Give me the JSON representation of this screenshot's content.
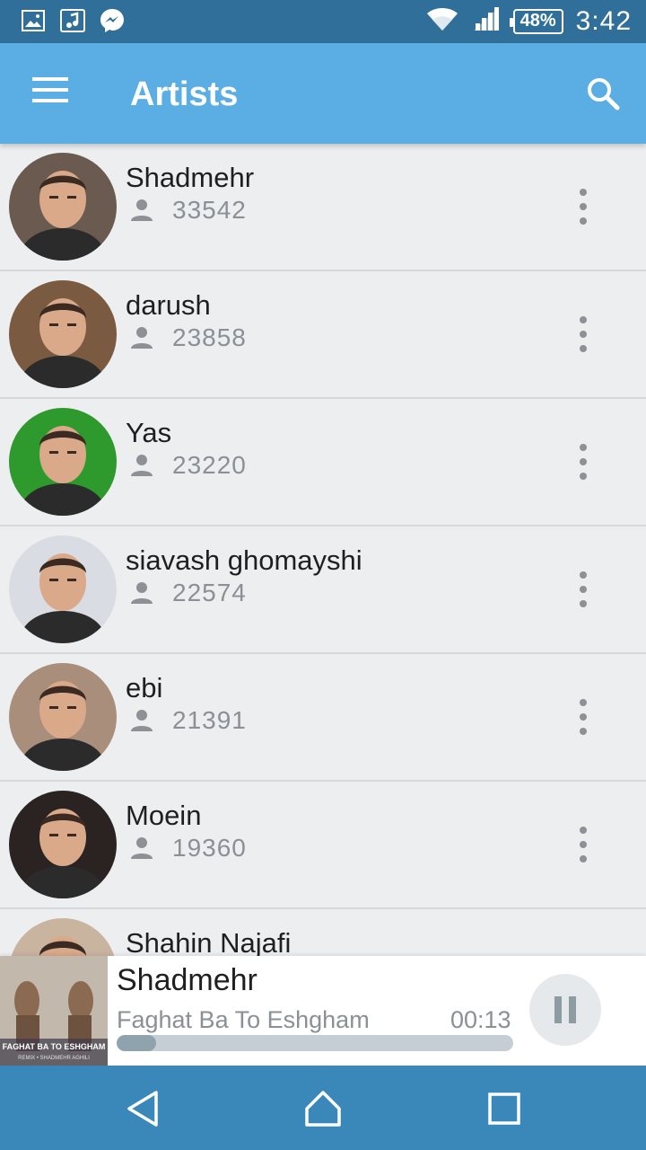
{
  "status_bar": {
    "battery": "48%",
    "time": "3:42",
    "left_icons": [
      "image-notification-icon",
      "music-notification-icon",
      "messenger-icon"
    ],
    "right_icons": [
      "wifi-icon",
      "signal-icon",
      "battery-icon"
    ]
  },
  "app_bar": {
    "title": "Artists",
    "menu_icon": "hamburger-menu-icon",
    "search_icon": "search-icon",
    "color": "#5aaee3"
  },
  "artists": [
    {
      "name": "Shadmehr",
      "followers": "33542",
      "avatar_color": "#6b5a4f"
    },
    {
      "name": "darush",
      "followers": "23858",
      "avatar_color": "#7a5a40"
    },
    {
      "name": "Yas",
      "followers": "23220",
      "avatar_color": "#2e9a2e"
    },
    {
      "name": "siavash ghomayshi",
      "followers": "22574",
      "avatar_color": "#d9dde3"
    },
    {
      "name": "ebi",
      "followers": "21391",
      "avatar_color": "#a98e7c"
    },
    {
      "name": "Moein",
      "followers": "19360",
      "avatar_color": "#2a2321"
    },
    {
      "name": "Shahin Najafi",
      "followers": "",
      "avatar_color": "#c9b4a0"
    }
  ],
  "player": {
    "artist": "Shadmehr",
    "song": "Faghat Ba To Eshgham",
    "elapsed": "00:13",
    "progress_percent": 10,
    "cover_text_line1": "FAGHAT BA TO ESHGHAM",
    "cover_text_line2": "REMIX • SHADMEHR AGHILI",
    "pause_icon": "pause-icon"
  },
  "nav_bar": {
    "back_icon": "back-triangle-icon",
    "home_icon": "home-icon",
    "recents_icon": "recents-square-icon"
  }
}
